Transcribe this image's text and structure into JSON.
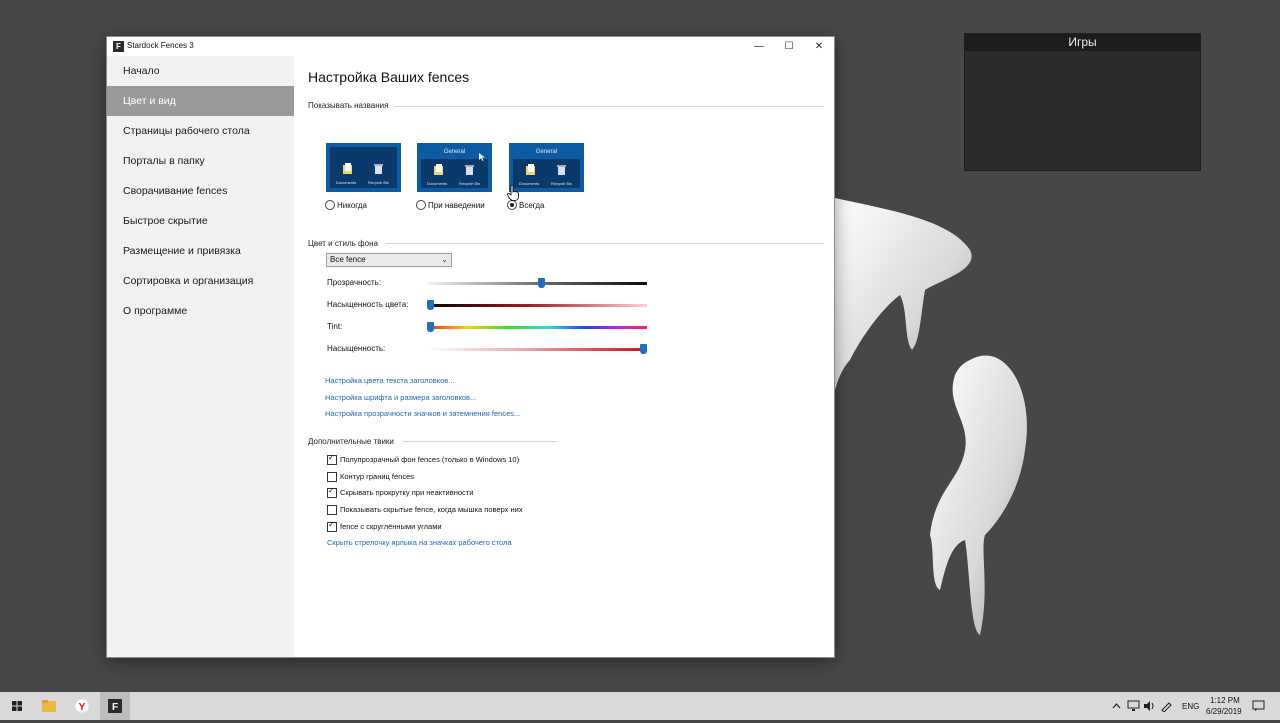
{
  "window": {
    "title": "Stardock Fences 3",
    "controls": {
      "minimize": "—",
      "maximize": "☐",
      "close": "✕"
    }
  },
  "sidebar": {
    "items": [
      {
        "label": "Начало",
        "active": false
      },
      {
        "label": "Цвет и вид",
        "active": true
      },
      {
        "label": "Страницы рабочего стола",
        "active": false
      },
      {
        "label": "Порталы в папку",
        "active": false
      },
      {
        "label": "Сворачивание fences",
        "active": false
      },
      {
        "label": "Быстрое скрытие",
        "active": false
      },
      {
        "label": "Размещение и привязка",
        "active": false
      },
      {
        "label": "Сортировка и организация",
        "active": false
      },
      {
        "label": "О программе",
        "active": false
      }
    ]
  },
  "main": {
    "title": "Настройка Ваших fences",
    "show_titles": {
      "section_label": "Показывать названия",
      "preview_header": "General",
      "preview_items": [
        "Documents",
        "Recycle Bin"
      ],
      "options": [
        {
          "label": "Никогда",
          "checked": false
        },
        {
          "label": "При наведении",
          "checked": false
        },
        {
          "label": "Всегда",
          "checked": true
        }
      ]
    },
    "color_style": {
      "section_label": "Цвет и стиль фона",
      "dropdown_value": "Все fence",
      "sliders": [
        {
          "label": "Прозрачность:",
          "value": 0.52
        },
        {
          "label": "Насыщенность цвета:",
          "value": 0.0
        },
        {
          "label": "Tint:",
          "value": 0.0
        },
        {
          "label": "Насыщенность:",
          "value": 1.0
        }
      ],
      "links": [
        "Настройка цвета текста заголовков...",
        "Настройка шрифта и размера заголовков...",
        "Настройка прозрачности значков и затемнения fences..."
      ]
    },
    "extra": {
      "section_label": "Дополнительные твики",
      "checkboxes": [
        {
          "label": "Полупрозрачный фон fences (только в Windows 10)",
          "checked": true
        },
        {
          "label": "Контур границ fences",
          "checked": false
        },
        {
          "label": "Скрывать прокрутку при неактивности",
          "checked": true
        },
        {
          "label": "Показывать скрытые fence, когда мышка поверх них",
          "checked": false
        },
        {
          "label": "fence с скруглёнными углами",
          "checked": true
        }
      ],
      "link": "Скрыть стрелочку ярлыка на значках рабочего стола"
    }
  },
  "desktop": {
    "fence_title": "Игры"
  },
  "taskbar": {
    "language": "ENG",
    "time": "1:12 PM",
    "date": "6/29/2019"
  },
  "colors": {
    "accent": "#1d6fc5",
    "link": "#1a66c2",
    "preview_bg": "#0d5ca3"
  }
}
